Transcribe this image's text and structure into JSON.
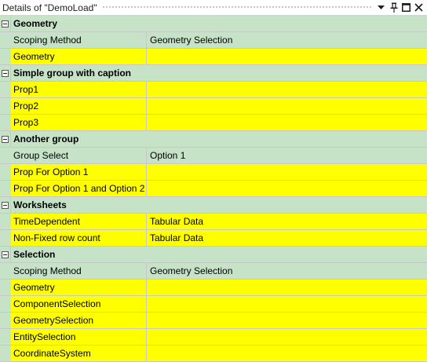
{
  "panel": {
    "title": "Details of \"DemoLoad\"",
    "pin_icon": "pin-icon",
    "dropdown_icon": "dropdown-arrow-icon",
    "maximize_icon": "maximize-icon",
    "close_icon": "close-icon"
  },
  "colors": {
    "group_bg": "#c6e3c8",
    "editable_bg": "#ffff00"
  },
  "groups": [
    {
      "title": "Geometry",
      "rows": [
        {
          "name": "Scoping Method",
          "value": "Geometry Selection",
          "style": "green"
        },
        {
          "name": "Geometry",
          "value": "",
          "style": "yellow"
        }
      ]
    },
    {
      "title": "Simple group with caption",
      "rows": [
        {
          "name": "Prop1",
          "value": "",
          "style": "yellow"
        },
        {
          "name": "Prop2",
          "value": "",
          "style": "yellow"
        },
        {
          "name": "Prop3",
          "value": "",
          "style": "yellow"
        }
      ]
    },
    {
      "title": "Another group",
      "rows": [
        {
          "name": "Group Select",
          "value": "Option 1",
          "style": "green"
        },
        {
          "name": "Prop For Option 1",
          "value": "",
          "style": "yellow"
        },
        {
          "name": "Prop For Option 1 and Option 2",
          "value": "",
          "style": "yellow"
        }
      ]
    },
    {
      "title": "Worksheets",
      "rows": [
        {
          "name": "TimeDependent",
          "value": "Tabular Data",
          "style": "yellow"
        },
        {
          "name": "Non-Fixed row count",
          "value": "Tabular Data",
          "style": "yellow"
        }
      ]
    },
    {
      "title": "Selection",
      "rows": [
        {
          "name": "Scoping Method",
          "value": "Geometry Selection",
          "style": "green"
        },
        {
          "name": "Geometry",
          "value": "",
          "style": "yellow"
        },
        {
          "name": "ComponentSelection",
          "value": "",
          "style": "yellow"
        },
        {
          "name": "GeometrySelection",
          "value": "",
          "style": "yellow"
        },
        {
          "name": "EntitySelection",
          "value": "",
          "style": "yellow"
        },
        {
          "name": "CoordinateSystem",
          "value": "",
          "style": "yellow"
        }
      ]
    }
  ]
}
